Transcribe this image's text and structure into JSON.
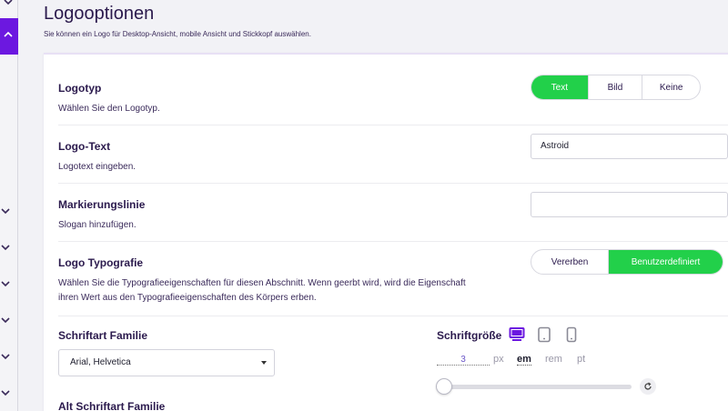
{
  "header": {
    "title": "Logooptionen",
    "subtitle": "Sie können ein Logo für Desktop-Ansicht, mobile Ansicht und Stickkopf auswählen."
  },
  "logotyp": {
    "title": "Logotyp",
    "desc": "Wählen Sie den Logotyp.",
    "options": [
      "Text",
      "Bild",
      "Keine"
    ],
    "selected": "Text"
  },
  "logo_text": {
    "title": "Logo-Text",
    "desc": "Logotext eingeben.",
    "value": "Astroid"
  },
  "tagline": {
    "title": "Markierungslinie",
    "desc": "Slogan hinzufügen.",
    "value": ""
  },
  "typography": {
    "title": "Logo Typografie",
    "desc": "Wählen Sie die Typografieeigenschaften für diesen Abschnitt. Wenn geerbt wird, wird die Eigenschaft ihren Wert aus den Typografieeigenschaften des Körpers erben.",
    "options": [
      "Vererben",
      "Benutzerdefiniert"
    ],
    "selected": "Benutzerdefiniert"
  },
  "font_family": {
    "title": "Schriftart Familie",
    "value": "Arial, Helvetica"
  },
  "font_size": {
    "title": "Schriftgröße",
    "value": "3",
    "units": [
      "px",
      "em",
      "rem",
      "pt"
    ],
    "selected_unit": "em",
    "devices": [
      "desktop-icon",
      "tablet-icon",
      "mobile-icon"
    ],
    "active_device": "desktop-icon"
  },
  "alt_font_family": {
    "title": "Alt Schriftart Familie"
  },
  "colors": {
    "accent": "#6c18e0",
    "active_toggle": "#22d04a"
  }
}
